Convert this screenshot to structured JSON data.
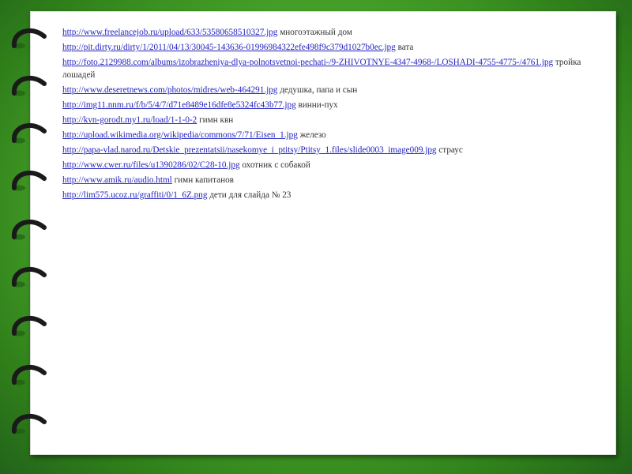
{
  "references": [
    {
      "url": "http://www.freelancejob.ru/upload/633/53580658510327.jpg",
      "desc": "многоэтажный дом"
    },
    {
      "url": "http://pit.dirty.ru/dirty/1/2011/04/13/30045-143636-01996984322efe498f9c379d1027b0ec.jpg",
      "desc": "вата"
    },
    {
      "url": "http://foto.2129988.com/albums/izobrazheniya-dlya-polnotsvetnoi-pechati-/9-ZHIVOTNYE-4347-4968-/LOSHADI-4755-4775-/4761.jpg",
      "desc": "тройка лошадей"
    },
    {
      "url": "http://www.deseretnews.com/photos/midres/web-464291.jpg",
      "desc": "дедушка, папа и сын"
    },
    {
      "url": "http://img11.nnm.ru/f/b/5/4/7/d71e8489e16dfe8e5324fc43b77.jpg",
      "desc": "винни-пух"
    },
    {
      "url": "http://kvn-gorodt.my1.ru/load/1-1-0-2",
      "desc": "гимн квн"
    },
    {
      "url": "http://upload.wikimedia.org/wikipedia/commons/7/71/Eisen_1.jpg",
      "desc": "железо"
    },
    {
      "url": "http://papa-vlad.narod.ru/Detskie_prezentatsii/nasekomye_i_ptitsy/Ptitsy_1.files/slide0003_image009.jpg",
      "desc": "страус"
    },
    {
      "url": "http://www.cwer.ru/files/u1390286/02/C28-10.jpg",
      "desc": "охотник с собакой"
    },
    {
      "url": "http://www.amik.ru/audio.html",
      "desc": "гимн капитанов"
    },
    {
      "url": "http://lim575.ucoz.ru/graffiti/0/1_6Z.png",
      "desc": "дети для слайда № 23"
    }
  ],
  "colors": {
    "background_green": "#4fae2e",
    "link_blue": "#1f1fbf",
    "text_gray": "#333333",
    "paper": "#ffffff",
    "ring": "#1a1a1a"
  },
  "icons": {
    "binder_ring": "binder-ring-icon"
  }
}
